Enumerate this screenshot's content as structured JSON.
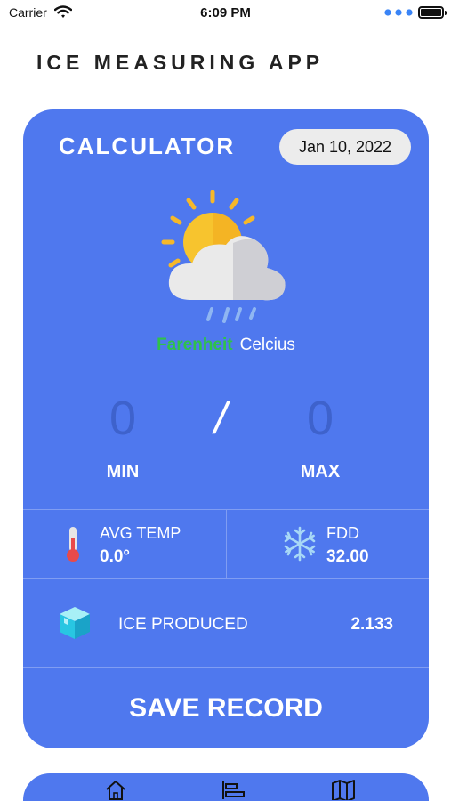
{
  "status_bar": {
    "carrier": "Carrier",
    "time": "6:09 PM",
    "icons": [
      "wifi-icon",
      "dots-icon",
      "battery-icon"
    ]
  },
  "app": {
    "title": "ICE MEASURING APP"
  },
  "calculator": {
    "title": "CALCULATOR",
    "date": "Jan 10, 2022",
    "weather_icon": "partly-cloudy-rain-icon",
    "units": {
      "fahrenheit": "Farenheit",
      "celsius": "Celcius",
      "selected": "Farenheit"
    },
    "min_value": "0",
    "max_value": "0",
    "separator": "/",
    "min_label": "MIN",
    "max_label": "MAX",
    "avg_temp": {
      "label": "AVG TEMP",
      "value": "0.0°",
      "icon": "thermometer-icon"
    },
    "fdd": {
      "label": "FDD",
      "value": "32.00",
      "icon": "snowflake-icon"
    },
    "ice_produced": {
      "label": "ICE PRODUCED",
      "value": "2.133",
      "icon": "ice-cube-icon"
    },
    "save_label": "SAVE RECORD"
  },
  "tab_bar": {
    "items": [
      "home-icon",
      "stats-icon",
      "map-icon"
    ]
  },
  "colors": {
    "card": "#4f78ee",
    "accent_green": "#2fc24a",
    "value_dim": "#3e62cc",
    "pill": "#ececec"
  }
}
